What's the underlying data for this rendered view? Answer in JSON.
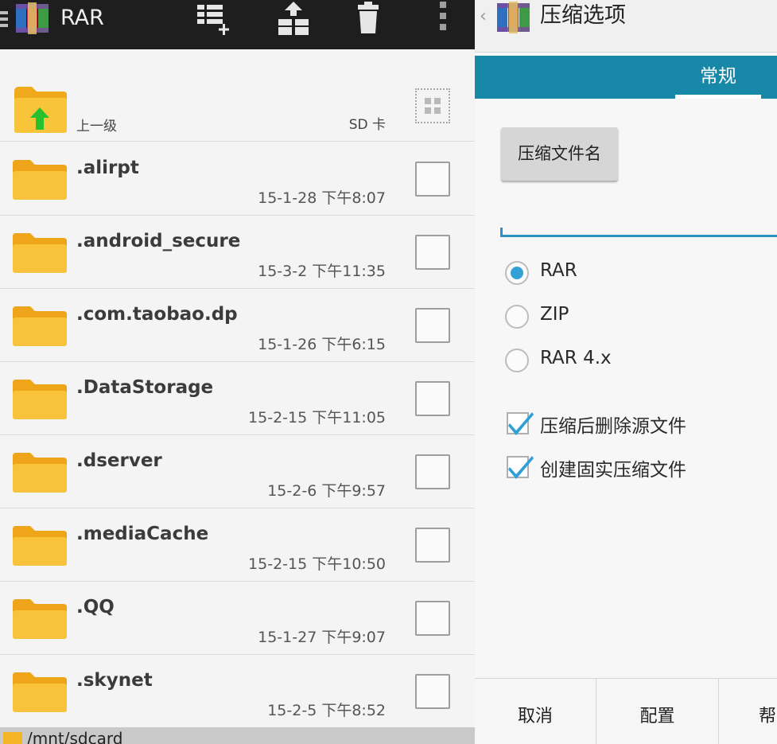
{
  "app": {
    "title": "RAR"
  },
  "toolbar": {
    "icons": [
      "select-list-add-icon",
      "archive-upload-icon",
      "trash-icon",
      "overflow-menu-icon"
    ]
  },
  "parent_row": {
    "label": "上一级",
    "location": "SD 卡"
  },
  "files": [
    {
      "name": ".alirpt",
      "date": "15-1-28 下午8:07"
    },
    {
      "name": ".android_secure",
      "date": "15-3-2 下午11:35"
    },
    {
      "name": ".com.taobao.dp",
      "date": "15-1-26 下午6:15"
    },
    {
      "name": ".DataStorage",
      "date": "15-2-15 下午11:05"
    },
    {
      "name": ".dserver",
      "date": "15-2-6 下午9:57"
    },
    {
      "name": ".mediaCache",
      "date": "15-2-15 下午10:50"
    },
    {
      "name": ".QQ",
      "date": "15-1-27 下午9:07"
    },
    {
      "name": ".skynet",
      "date": "15-2-5 下午8:52"
    }
  ],
  "path": "/mnt/sdcard",
  "dialog": {
    "title": "压缩选项",
    "tab_general": "常规",
    "archive_name_button": "压缩文件名",
    "archive_name_value": "",
    "formats": [
      {
        "label": "RAR",
        "selected": true
      },
      {
        "label": "ZIP",
        "selected": false
      },
      {
        "label": "RAR 4.x",
        "selected": false
      }
    ],
    "options": [
      {
        "label": "压缩后删除源文件",
        "checked": true
      },
      {
        "label": "创建固实压缩文件",
        "checked": true
      }
    ],
    "buttons": {
      "cancel": "取消",
      "profiles": "配置",
      "help": "帮"
    }
  },
  "colors": {
    "accent": "#1788a8",
    "radio": "#33a1d6",
    "topbar": "#1e1e1e",
    "folder": "#f6b620"
  }
}
